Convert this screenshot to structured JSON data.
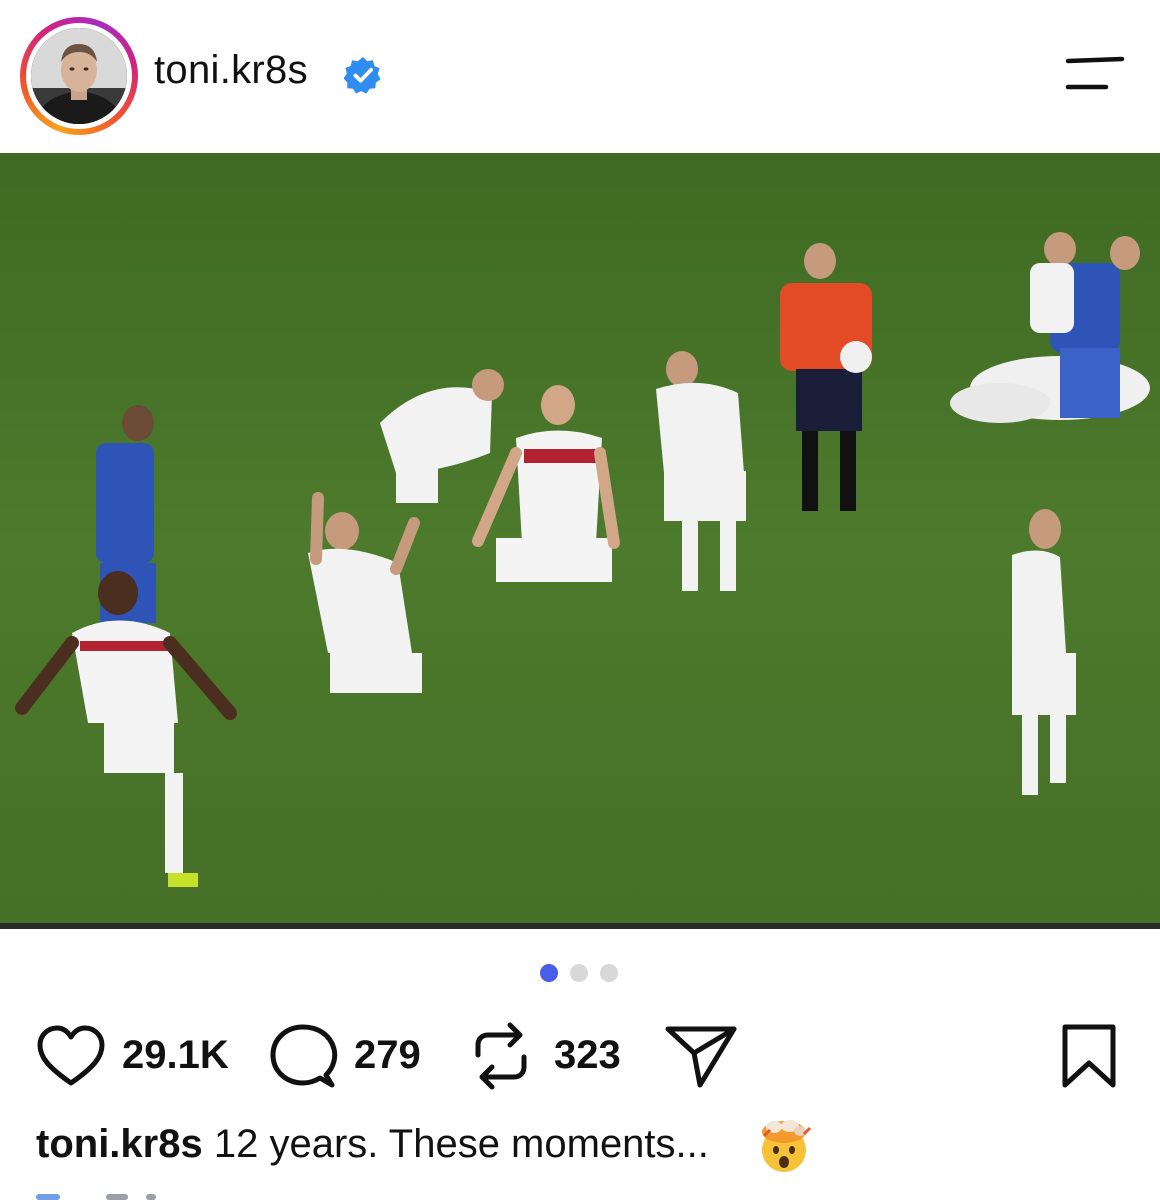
{
  "header": {
    "username": "toni.kr8s",
    "verified": true,
    "avatar_icon": "profile-photo",
    "menu_icon": "menu-icon"
  },
  "post": {
    "photo_icon": "football-celebration-photo",
    "carousel": {
      "total": 3,
      "active_index": 0,
      "active_color": "#4a5de8",
      "inactive_color": "#d8d8d8"
    },
    "actions": {
      "likes": "29.1K",
      "comments": "279",
      "reposts": "323",
      "share_icon": "send-icon",
      "save_icon": "bookmark-icon"
    },
    "caption": {
      "username": "toni.kr8s",
      "text": "12 years. These moments...",
      "emoji": "exploding-head-emoji"
    }
  },
  "colors": {
    "verified_blue": "#2f8cf0",
    "text": "#111111",
    "pitch_green": "#4f7a2e"
  }
}
